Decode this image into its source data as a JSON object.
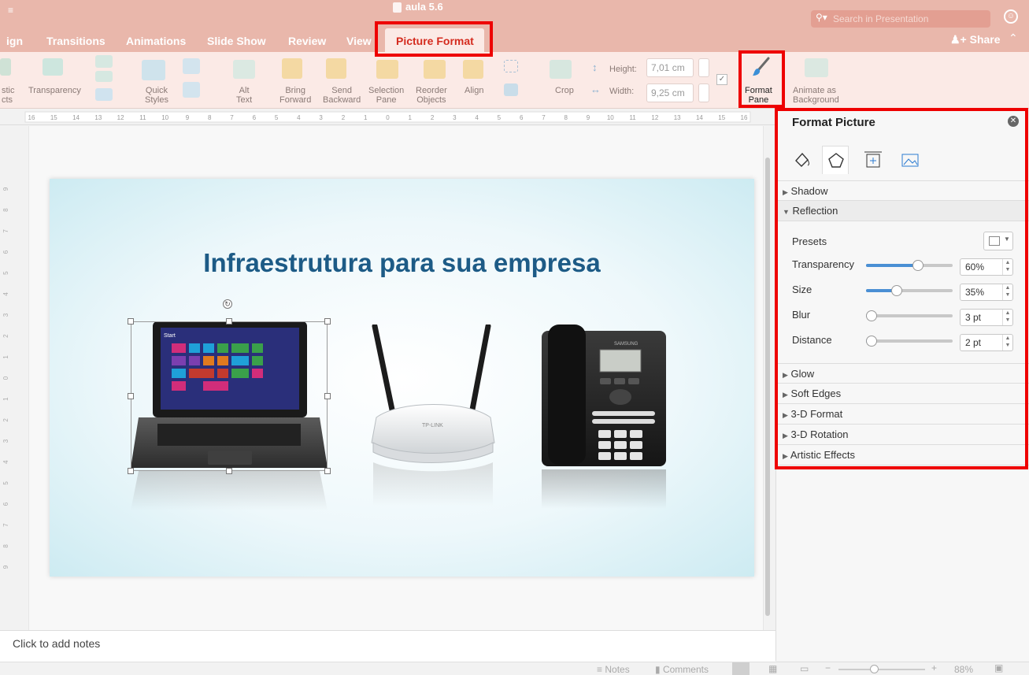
{
  "window": {
    "doc_title": "aula 5.6",
    "search_placeholder": "Search in Presentation",
    "share_label": "Share"
  },
  "tabs": [
    {
      "label": "ign"
    },
    {
      "label": "Transitions"
    },
    {
      "label": "Animations"
    },
    {
      "label": "Slide Show"
    },
    {
      "label": "Review"
    },
    {
      "label": "View"
    },
    {
      "label": "Picture Format"
    }
  ],
  "ribbon": {
    "artistic_effects": "stic\ncts",
    "transparency": "Transparency",
    "quick_styles": "Quick\nStyles",
    "alt_text": "Alt\nText",
    "bring_forward": "Bring\nForward",
    "send_backward": "Send\nBackward",
    "selection_pane": "Selection\nPane",
    "reorder_objects": "Reorder\nObjects",
    "align": "Align",
    "crop": "Crop",
    "height_label": "Height:",
    "height_value": "7,01 cm",
    "width_label": "Width:",
    "width_value": "9,25 cm",
    "format_pane": "Format\nPane",
    "animate_as_background": "Animate as\nBackground"
  },
  "ruler_ticks": [
    "16",
    "15",
    "14",
    "13",
    "12",
    "11",
    "10",
    "9",
    "8",
    "7",
    "6",
    "5",
    "4",
    "3",
    "2",
    "1",
    "0",
    "1",
    "2",
    "3",
    "4",
    "5",
    "6",
    "7",
    "8",
    "9",
    "10",
    "11",
    "12",
    "13",
    "14",
    "15",
    "16"
  ],
  "vruler_ticks": [
    "9",
    "8",
    "7",
    "6",
    "5",
    "4",
    "3",
    "2",
    "1",
    "0",
    "1",
    "2",
    "3",
    "4",
    "5",
    "6",
    "7",
    "8",
    "9"
  ],
  "slide": {
    "title": "Infraestrutura para sua empresa",
    "laptop_screen_start": "Start",
    "router_brand": "TP-LINK",
    "phone_brand": "SAMSUNG"
  },
  "notes": {
    "placeholder": "Click to add notes"
  },
  "pane": {
    "title": "Format Picture",
    "sections": {
      "shadow": "Shadow",
      "reflection": "Reflection",
      "glow": "Glow",
      "soft_edges": "Soft Edges",
      "format_3d": "3-D Format",
      "rotation_3d": "3-D Rotation",
      "artistic_effects": "Artistic Effects"
    },
    "presets_label": "Presets",
    "reflection_props": [
      {
        "label": "Transparency",
        "value": "60%",
        "level": 0.6
      },
      {
        "label": "Size",
        "value": "35%",
        "level": 0.35
      },
      {
        "label": "Blur",
        "value": "3 pt",
        "level": 0.03
      },
      {
        "label": "Distance",
        "value": "2 pt",
        "level": 0.02
      }
    ]
  },
  "status": {
    "notes": "Notes",
    "comments": "Comments",
    "zoom": "88%"
  },
  "colors": {
    "accent": "#e00000",
    "ribbon_tab_bg": "#e9b7ab",
    "title_blue": "#1d5b86",
    "slider_blue": "#4a8fd4"
  }
}
